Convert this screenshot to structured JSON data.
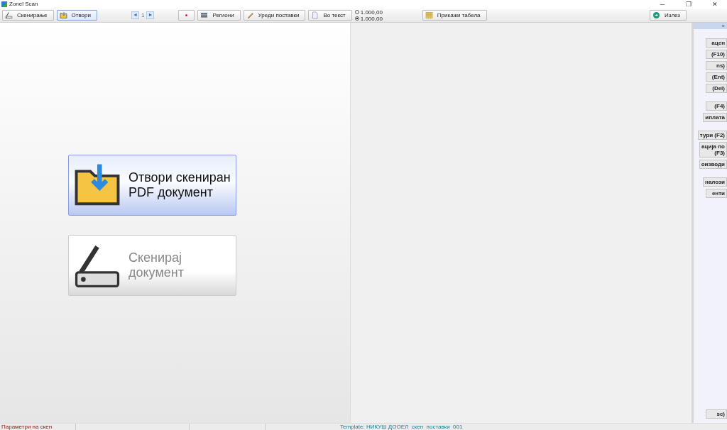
{
  "window": {
    "title": "Zonel Scan",
    "controls": [
      "─",
      "❐",
      "✕"
    ]
  },
  "toolbar": [
    {
      "kind": "button",
      "label": "Скенирање",
      "selected": false
    },
    {
      "kind": "button",
      "label": "Отвори",
      "selected": true
    },
    {
      "kind": "pager",
      "prev": "◄",
      "page": "1",
      "next": "►"
    },
    {
      "kind": "button",
      "selected": false
    },
    {
      "kind": "button",
      "label": "Региони",
      "selected": false
    },
    {
      "kind": "button",
      "label": "Уреди поставки",
      "selected": false
    },
    {
      "kind": "button",
      "label": "Во текст",
      "selected": false
    },
    {
      "kind": "radios",
      "options": [
        {
          "label": "1.000,00",
          "selected": false
        },
        {
          "label": "1.000,00",
          "selected": true
        }
      ]
    },
    {
      "kind": "button",
      "label": "Прикажи табела",
      "selected": false
    },
    {
      "kind": "spacer"
    },
    {
      "kind": "button",
      "label": "Излез",
      "selected": false
    }
  ],
  "actions": [
    {
      "lines": [
        "Отвори скениран",
        "PDF документ"
      ],
      "selected": true
    },
    {
      "lines": [
        "Скенирај",
        "документ"
      ],
      "selected": false
    }
  ],
  "side_panel": {
    "collapse": "«",
    "buttons": [
      "ацен",
      "(F10)",
      "ns)",
      "(Ent)",
      "(Del)",
      "(F4)",
      "иплата",
      "тури (F2)",
      "ација по\n(F3)",
      "оизводи",
      "налози",
      "енти"
    ],
    "bottom_button": "sc)"
  },
  "status_bar": {
    "left": "Параметри на скен",
    "template": "Template: НИКУШ ДООЕЛ  скен  поставки  001"
  }
}
